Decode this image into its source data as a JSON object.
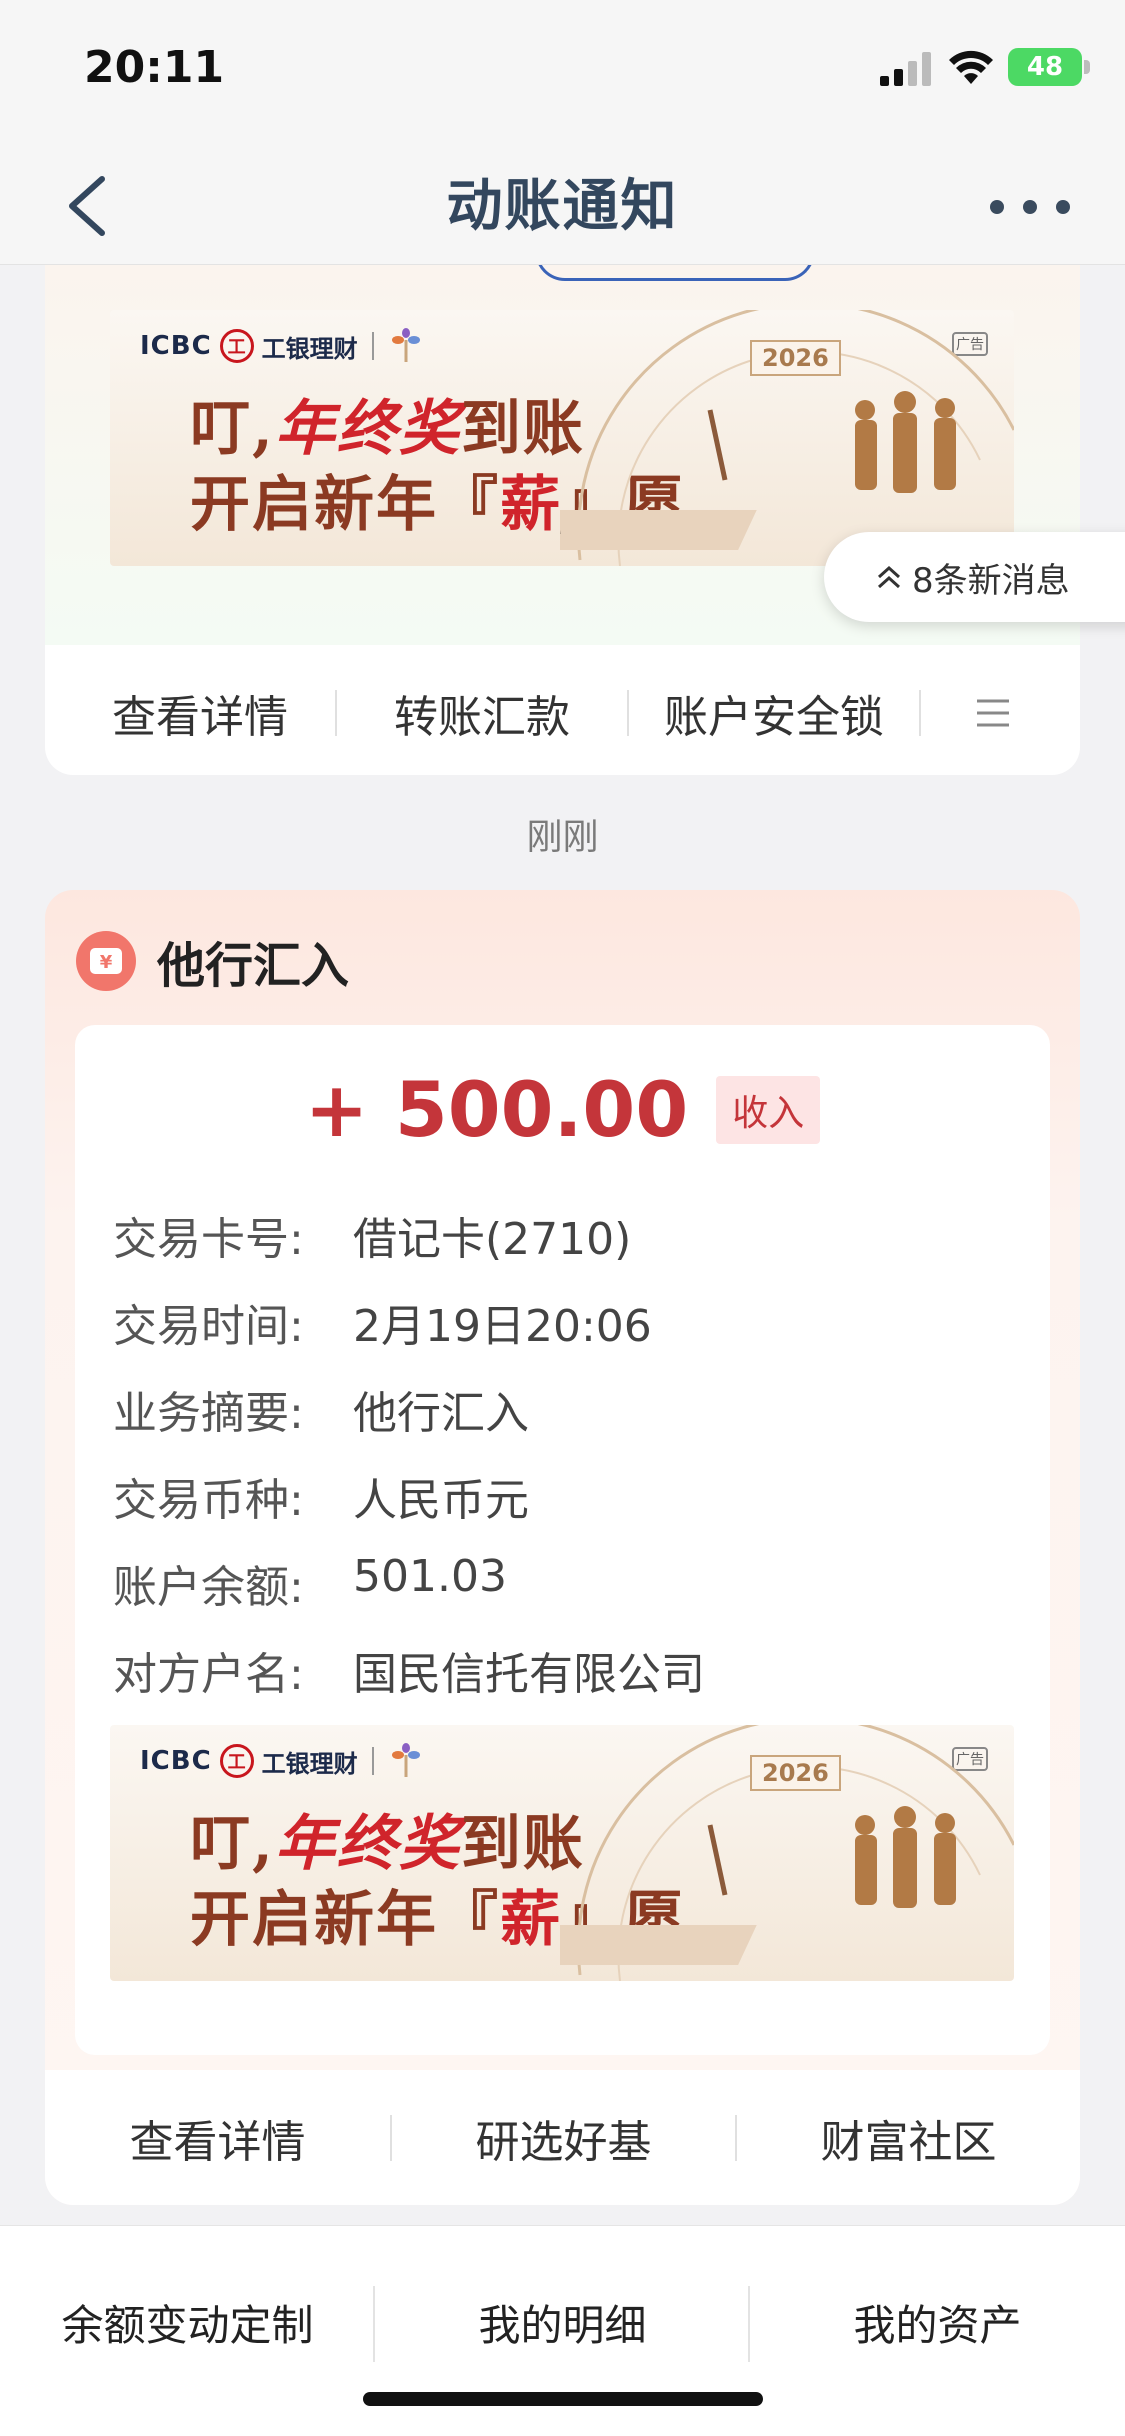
{
  "status_bar": {
    "time": "20:11",
    "battery": "48"
  },
  "nav": {
    "title": "动账通知"
  },
  "banner": {
    "icbc": "ICBC",
    "brand": "工银理财",
    "ad_tag": "广告",
    "line1_prefix": "叮,",
    "line1_highlight": "年终奖",
    "line1_suffix": "到账",
    "line2_prefix": "开启新年『",
    "line2_highlight": "薪",
    "line2_suffix": "』愿",
    "year": "2026"
  },
  "top_card": {
    "actions": [
      "查看详情",
      "转账汇款",
      "账户安全锁"
    ]
  },
  "new_messages": "8条新消息",
  "time_label": "刚刚",
  "transaction": {
    "title": "他行汇入",
    "amount": "+ 500.00",
    "amount_tag": "收入",
    "details": [
      {
        "label": "交易卡号:",
        "value": "借记卡(2710)"
      },
      {
        "label": "交易时间:",
        "value": "2月19日20:06"
      },
      {
        "label": "业务摘要:",
        "value": "他行汇入"
      },
      {
        "label": "交易币种:",
        "value": "人民币元"
      },
      {
        "label": "账户余额:",
        "value": "501.03"
      },
      {
        "label": "对方户名:",
        "value": "国民信托有限公司"
      }
    ],
    "actions": [
      "查看详情",
      "研选好基",
      "财富社区"
    ]
  },
  "tab_bar": {
    "items": [
      "余额变动定制",
      "我的明细",
      "我的资产"
    ]
  },
  "colors": {
    "accent_red": "#c4353a",
    "nav_title": "#33475e",
    "battery": "#4cd964"
  },
  "icons": [
    "signal-icon",
    "wifi-icon",
    "back-arrow-icon",
    "more-icon",
    "menu-icon",
    "chevron-up-icon",
    "yuan-icon",
    "icbc-logo",
    "leaf-icon"
  ]
}
